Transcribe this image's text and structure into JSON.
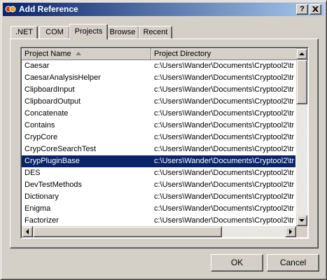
{
  "window": {
    "title": "Add Reference"
  },
  "title_buttons": {
    "help": "?",
    "close": "X"
  },
  "tabs": [
    {
      "label": ".NET"
    },
    {
      "label": "COM"
    },
    {
      "label": "Projects",
      "active": true
    },
    {
      "label": "Browse"
    },
    {
      "label": "Recent"
    }
  ],
  "list": {
    "columns": [
      "Project Name",
      "Project Directory"
    ],
    "sort_column": "Project Name",
    "sort_direction": "ascending",
    "rows": [
      {
        "name": "Caesar",
        "dir": "c:\\Users\\Wander\\Documents\\Cryptool2\\tr"
      },
      {
        "name": "CaesarAnalysisHelper",
        "dir": "c:\\Users\\Wander\\Documents\\Cryptool2\\tr"
      },
      {
        "name": "ClipboardInput",
        "dir": "c:\\Users\\Wander\\Documents\\Cryptool2\\tr"
      },
      {
        "name": "ClipboardOutput",
        "dir": "c:\\Users\\Wander\\Documents\\Cryptool2\\tr"
      },
      {
        "name": "Concatenate",
        "dir": "c:\\Users\\Wander\\Documents\\Cryptool2\\tr"
      },
      {
        "name": "Contains",
        "dir": "c:\\Users\\Wander\\Documents\\Cryptool2\\tr"
      },
      {
        "name": "CrypCore",
        "dir": "c:\\Users\\Wander\\Documents\\Cryptool2\\tr"
      },
      {
        "name": "CrypCoreSearchTest",
        "dir": "c:\\Users\\Wander\\Documents\\Cryptool2\\tr"
      },
      {
        "name": "CrypPluginBase",
        "dir": "c:\\Users\\Wander\\Documents\\Cryptool2\\tr",
        "selected": true
      },
      {
        "name": "DES",
        "dir": "c:\\Users\\Wander\\Documents\\Cryptool2\\tr"
      },
      {
        "name": "DevTestMethods",
        "dir": "c:\\Users\\Wander\\Documents\\Cryptool2\\tr"
      },
      {
        "name": "Dictionary",
        "dir": "c:\\Users\\Wander\\Documents\\Cryptool2\\tr"
      },
      {
        "name": "Enigma",
        "dir": "c:\\Users\\Wander\\Documents\\Cryptool2\\tr"
      },
      {
        "name": "Factorizer",
        "dir": "c:\\Users\\Wander\\Documents\\Cryptool2\\tr"
      }
    ]
  },
  "buttons": {
    "ok": "OK",
    "cancel": "Cancel"
  },
  "colors": {
    "selection": "#0a246a",
    "face": "#d4d0c8",
    "title_start": "#0a246a",
    "title_end": "#a6caf0"
  }
}
